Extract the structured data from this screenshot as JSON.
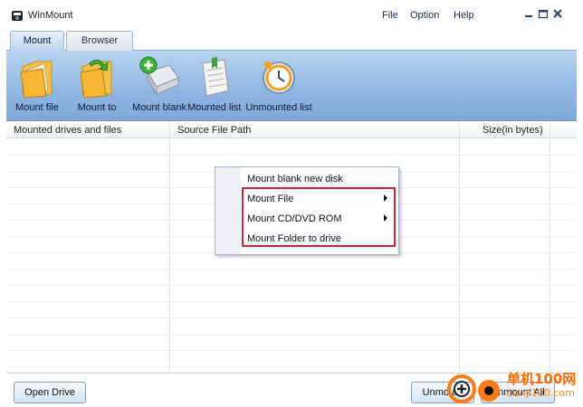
{
  "app": {
    "title": "WinMount",
    "icon": "winmount-logo-icon"
  },
  "menu": {
    "file": "File",
    "option": "Option",
    "help": "Help"
  },
  "window_controls": [
    "minimize-icon",
    "maximize-icon",
    "close-icon"
  ],
  "tabs": [
    {
      "label": "Mount",
      "active": true
    },
    {
      "label": "Browser",
      "active": false
    }
  ],
  "toolbar": {
    "items": [
      {
        "label": "Mount file",
        "icon": "folder-file-icon"
      },
      {
        "label": "Mount to",
        "icon": "folder-arrow-icon"
      },
      {
        "label": "Mount blank",
        "icon": "disk-add-icon"
      },
      {
        "label": "Mounted list",
        "icon": "document-list-icon"
      },
      {
        "label": "Unmounted list",
        "icon": "clock-disk-icon"
      }
    ]
  },
  "list": {
    "columns": [
      "Mounted drives and files",
      "Source File Path",
      "Size(in bytes)"
    ],
    "rows": []
  },
  "context_menu": {
    "items": [
      {
        "label": "Mount blank new disk",
        "submenu": false
      },
      {
        "label": "Mount File",
        "submenu": true
      },
      {
        "label": "Mount CD/DVD ROM",
        "submenu": true
      },
      {
        "label": "Mount Folder to drive",
        "submenu": false
      }
    ],
    "highlight_color": "#d9223a"
  },
  "buttons": {
    "open_drive": "Open Drive",
    "unmount": "Unmount",
    "unmount_all": "Unmount All"
  },
  "watermark": {
    "text": "单机100网",
    "sub": "danji100.com",
    "icon": "plus-circle-logo-icon"
  },
  "colors": {
    "toolbar": "#8fb6e2",
    "accent": "#d9223a",
    "watermark": "#ff6a00"
  }
}
